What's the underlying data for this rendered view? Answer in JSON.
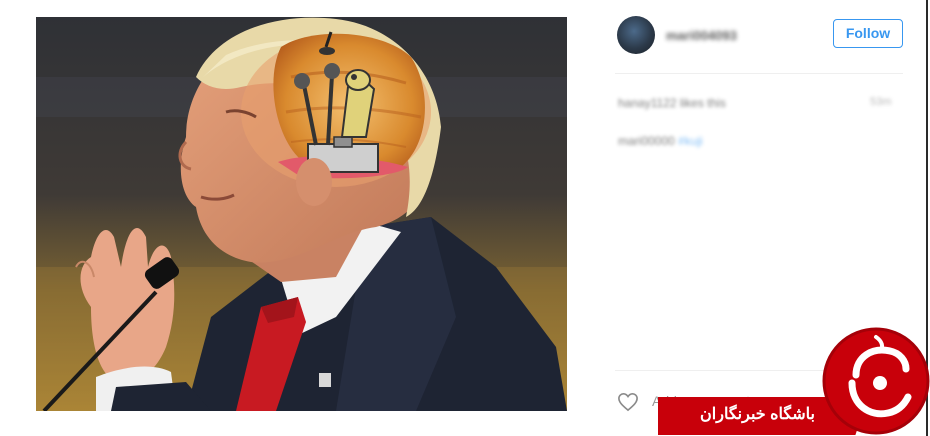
{
  "post": {
    "image_alt": "Photo of a man in a suit speaking at a microphone with a cartoon character inside his head"
  },
  "header": {
    "username": "mari004093",
    "follow_label": "Follow"
  },
  "meta": {
    "likes_text": "hanay1122 likes this",
    "time_text": "53m"
  },
  "comments": [
    {
      "user": "mari00000",
      "text": "#kuji"
    }
  ],
  "actions": {
    "add_comment_placeholder": "Add a comment..."
  },
  "watermark": {
    "text": "باشگاه خبرنگاران"
  },
  "colors": {
    "accent": "#3897f0",
    "watermark_red": "#c8000a"
  }
}
